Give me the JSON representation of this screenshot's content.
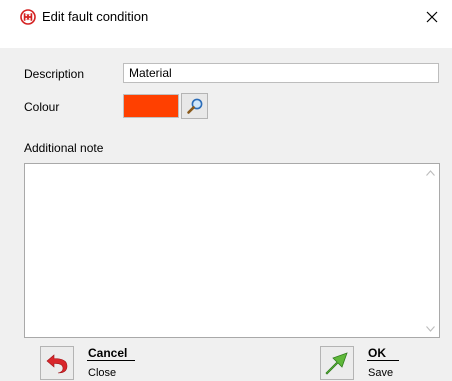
{
  "window": {
    "title": "Edit fault condition"
  },
  "colors": {
    "selected_colour": "#ff4000",
    "app_icon": "#d42020"
  },
  "form": {
    "description_label": "Description",
    "description_value": "Material",
    "colour_label": "Colour",
    "note_label": "Additional note",
    "note_value": ""
  },
  "footer": {
    "cancel_title": "Cancel",
    "cancel_sub": "Close",
    "ok_title": "OK",
    "ok_sub": "Save"
  }
}
